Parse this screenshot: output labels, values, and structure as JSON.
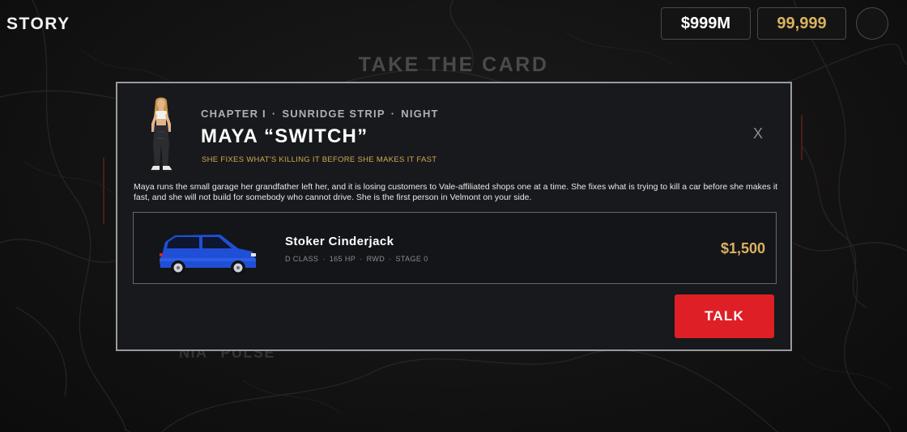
{
  "topbar": {
    "title": "STORY",
    "money": "$999M",
    "coins": "99,999"
  },
  "background": {
    "heading": "TAKE THE CARD",
    "subtext": "NIA \"PULSE\""
  },
  "modal": {
    "meta": {
      "chapter": "CHAPTER I",
      "location": "SUNRIDGE STRIP",
      "time": "NIGHT",
      "separator": "·"
    },
    "name": "MAYA  “SWITCH”",
    "tagline": "SHE FIXES WHAT'S KILLING IT BEFORE SHE MAKES IT FAST",
    "close_label": "X",
    "description": "Maya runs the small garage her grandfather left her, and it is losing customers to Vale-affiliated shops one at a time. She fixes what is trying to kill a car before she makes it fast, and she will not build for somebody who cannot drive. She is the first person in Velmont on your side.",
    "car": {
      "name": "Stoker Cinderjack",
      "specs": {
        "class": "D CLASS",
        "hp": "165 HP",
        "drive": "RWD",
        "stage": "STAGE 0"
      },
      "price": "$1,500",
      "color": "#1f4fd6"
    },
    "talk_label": "TALK"
  },
  "colors": {
    "accent_gold": "#d9b262",
    "button_red": "#df1f26",
    "modal_bg": "#18191c"
  }
}
